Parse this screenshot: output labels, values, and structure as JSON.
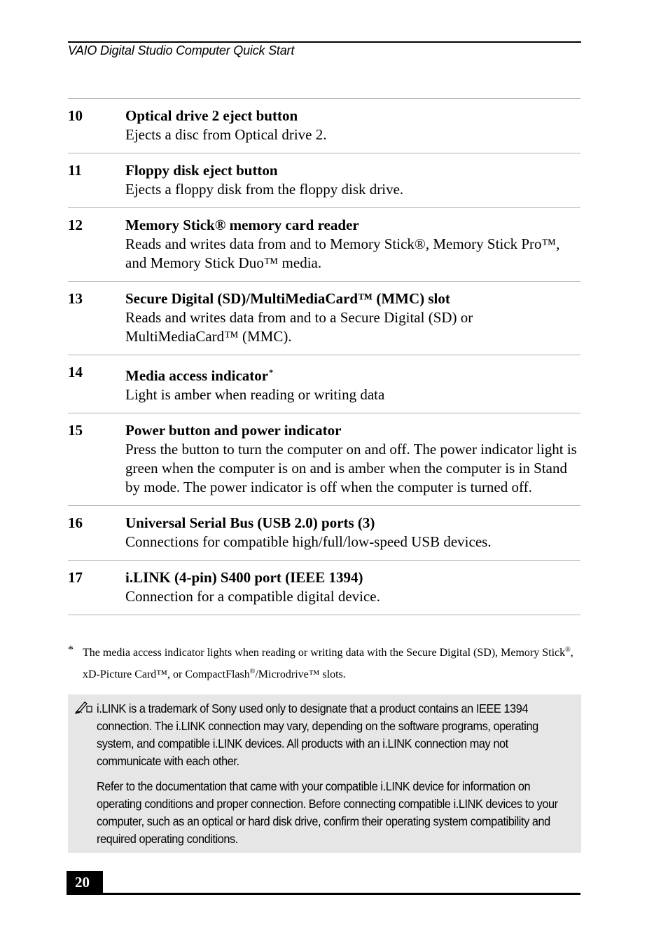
{
  "header": {
    "running_title": "VAIO Digital Studio Computer Quick Start"
  },
  "items": [
    {
      "number": "10",
      "title": "Optical drive 2 eject button",
      "title_sup": "",
      "description": "Ejects a disc from Optical drive 2."
    },
    {
      "number": "11",
      "title": "Floppy disk eject button",
      "title_sup": "",
      "description": "Ejects a floppy disk from the floppy disk drive."
    },
    {
      "number": "12",
      "title": "Memory Stick® memory card reader",
      "title_sup": "",
      "description": "Reads and writes data from and to Memory Stick®, Memory Stick Pro™, and Memory Stick Duo™ media."
    },
    {
      "number": "13",
      "title": "Secure Digital (SD)/MultiMediaCard™ (MMC) slot",
      "title_sup": "",
      "description": "Reads and writes data from and to a Secure Digital (SD) or MultiMediaCard™ (MMC)."
    },
    {
      "number": "14",
      "title": "Media access indicator",
      "title_sup": "*",
      "description": "Light is amber when reading or writing data"
    },
    {
      "number": "15",
      "title": "Power button and power indicator",
      "title_sup": "",
      "description": "Press the button to turn the computer on and off. The power indicator light is green when the computer is on and is amber when the computer is in Stand by mode. The power indicator is off when the computer is turned off."
    },
    {
      "number": "16",
      "title": "Universal Serial Bus (USB 2.0) ports (3)",
      "title_sup": "",
      "description": "Connections for compatible high/full/low-speed USB devices."
    },
    {
      "number": "17",
      "title": "i.LINK (4-pin) S400 port (IEEE 1394)",
      "title_sup": "",
      "description": "Connection for a compatible digital device."
    }
  ],
  "footnote": {
    "mark": "*",
    "text_part1": "The media access indicator lights when reading or writing data with the Secure Digital (SD), Memory Stick",
    "sup1": "®",
    "text_part2": ", xD-Picture Card™, or CompactFlash",
    "sup2": "®",
    "text_part3": "/Microdrive™ slots."
  },
  "note": {
    "icon": "pencil-note-icon",
    "paragraphs": [
      "i.LINK is a trademark of Sony used only to designate that a product contains an IEEE 1394 connection. The i.LINK connection may vary, depending on the software programs, operating system, and compatible i.LINK devices. All products with an i.LINK connection may not communicate with each other.",
      "Refer to the documentation that came with your compatible i.LINK device for information on operating conditions and proper connection. Before connecting compatible i.LINK devices to your computer, such as an optical or hard disk drive, confirm their operating system compatibility and required operating conditions."
    ]
  },
  "footer": {
    "page_number": "20"
  }
}
